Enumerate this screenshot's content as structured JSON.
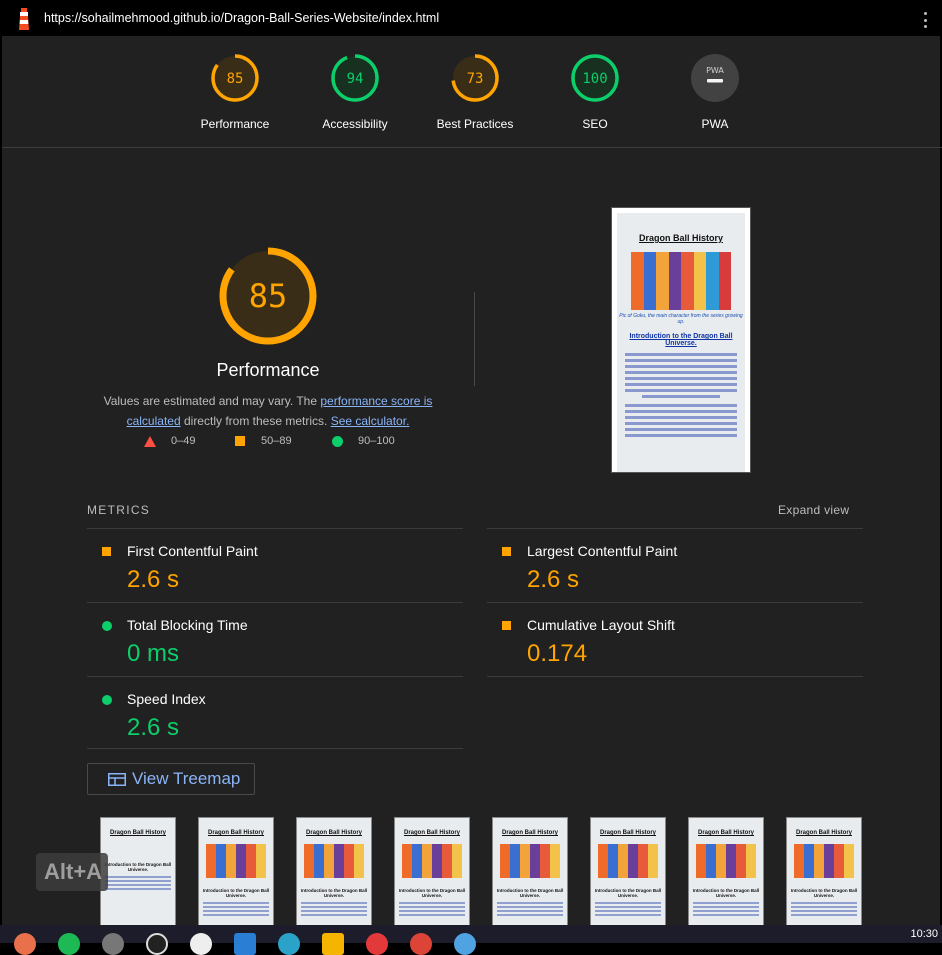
{
  "url": "https://sohailmehmood.github.io/Dragon-Ball-Series-Website/index.html",
  "top_scores": [
    {
      "label": "Performance",
      "score": "85",
      "value": 85,
      "color": "#ffa400"
    },
    {
      "label": "Accessibility",
      "score": "94",
      "value": 94,
      "color": "#0cce6b"
    },
    {
      "label": "Best Practices",
      "score": "73",
      "value": 73,
      "color": "#ffa400"
    },
    {
      "label": "SEO",
      "score": "100",
      "value": 100,
      "color": "#0cce6b"
    },
    {
      "label": "PWA",
      "score": "PWA",
      "value": null,
      "color": "#9e9e9e"
    }
  ],
  "main_gauge": {
    "score": "85",
    "value": 85,
    "title": "Performance"
  },
  "description": {
    "prefix": "Values are estimated and may vary. The ",
    "link1": "performance score is calculated",
    "middle": " directly from these metrics. ",
    "link2": "See calculator."
  },
  "legend": {
    "fail": "0–49",
    "average": "50–89",
    "pass": "90–100"
  },
  "screenshot": {
    "title": "Dragon Ball History",
    "caption": "Pic of Goku, the main character from the series growing up.",
    "heading": "Introduction to the Dragon Ball Universe."
  },
  "metrics_header": "METRICS",
  "expand_view": "Expand view",
  "metrics": [
    {
      "name": "First Contentful Paint",
      "value": "2.6 s",
      "status": "average",
      "color": "#ffa400"
    },
    {
      "name": "Largest Contentful Paint",
      "value": "2.6 s",
      "status": "average",
      "color": "#ffa400"
    },
    {
      "name": "Total Blocking Time",
      "value": "0 ms",
      "status": "pass",
      "color": "#0cce6b"
    },
    {
      "name": "Cumulative Layout Shift",
      "value": "0.174",
      "status": "average",
      "color": "#ffa400"
    },
    {
      "name": "Speed Index",
      "value": "2.6 s",
      "status": "pass",
      "color": "#0cce6b"
    }
  ],
  "treemap_button": "View Treemap",
  "thumbnails": {
    "title": "Dragon Ball History",
    "heading": "Introduction to the Dragon Ball Universe.",
    "count": 8
  },
  "overlay_hint": "Alt+A",
  "clock": "10:30",
  "colors": {
    "accent": "#ffa400",
    "pass": "#0cce6b",
    "fail": "#ff4e42",
    "link": "#8ab4f8"
  }
}
